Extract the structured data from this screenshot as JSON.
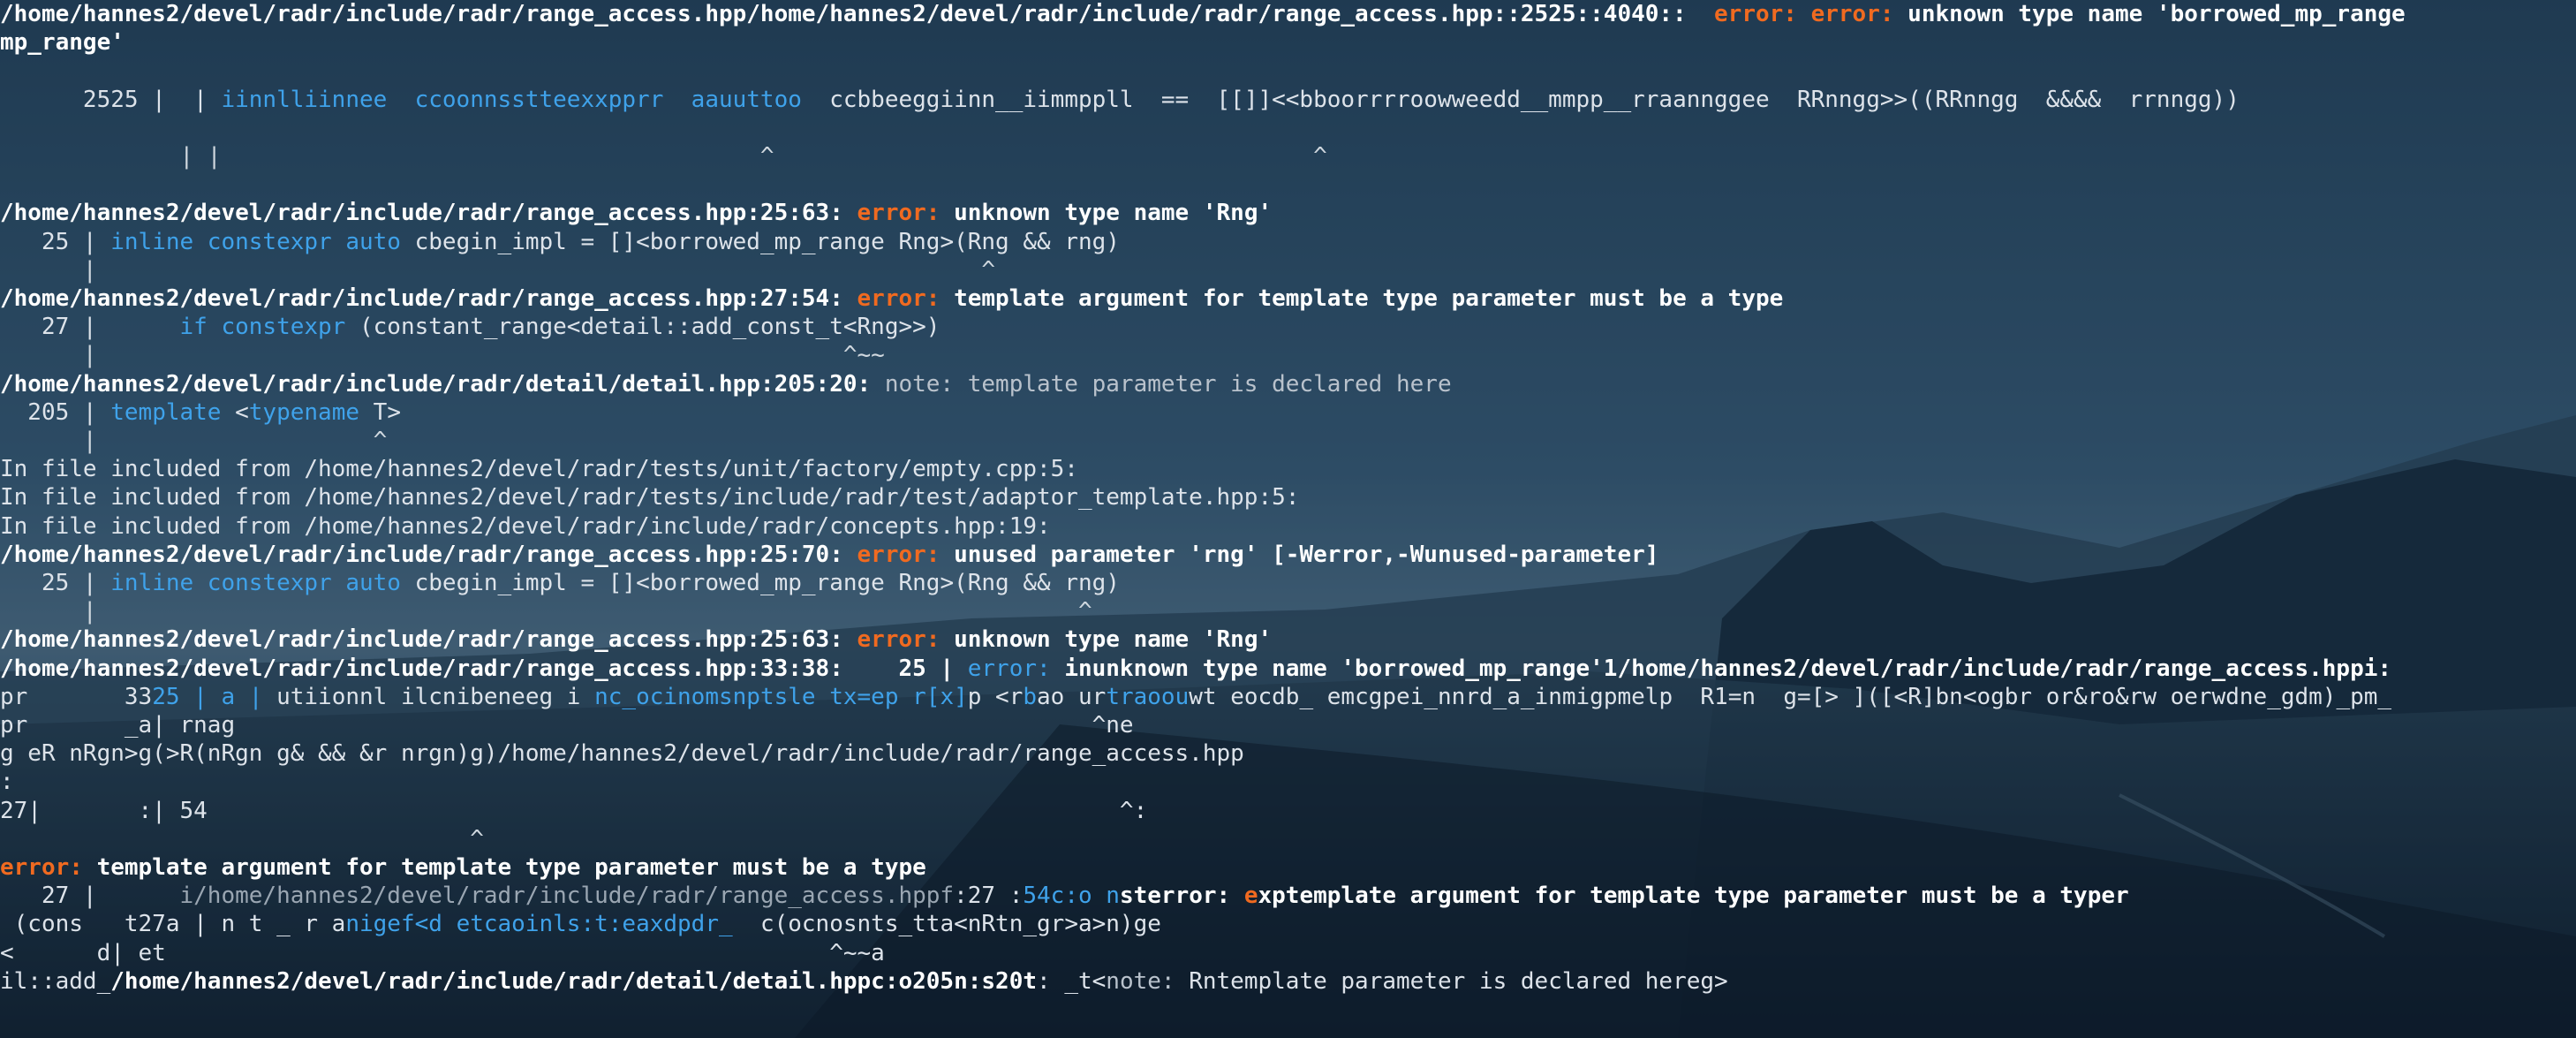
{
  "theme": {
    "bg": "#1d3b52",
    "error": "#f06a20",
    "keyword": "#3fa2ea",
    "text": "#dde3ea"
  },
  "lines": [
    [
      {
        "t": "path",
        "v": "/home/hannes2/devel/radr/include/radr/range_access.hpp/home/hannes2/devel/radr/include/radr/range_access.hpp::2525::4040::  "
      },
      {
        "t": "err",
        "v": "error: error: "
      },
      {
        "t": "msg",
        "v": "unknown type name 'borrowed_mp_range"
      }
    ],
    [
      {
        "t": "path",
        "v": "mp_range'"
      }
    ],
    [],
    [
      {
        "t": "code",
        "v": "      2525 |  | "
      },
      {
        "t": "kw",
        "v": "iinnlliinnee  ccoonnsstteexxpprr  aauuttoo"
      },
      {
        "t": "code",
        "v": "  ccbbeeggiinn__iimmppll  ==  [[]]<<bboorrrroowweedd__mmpp__rraannggee  RRnngg>>((RRnngg  &&&&  rrnngg))"
      }
    ],
    [],
    [
      {
        "t": "caret",
        "v": "             | |                                       ^                                       ^"
      }
    ],
    [],
    [
      {
        "t": "path",
        "v": "/home/hannes2/devel/radr/include/radr/range_access.hpp:25:63: "
      },
      {
        "t": "err",
        "v": "error: "
      },
      {
        "t": "msg",
        "v": "unknown type name 'Rng'"
      }
    ],
    [
      {
        "t": "code",
        "v": "   25 | "
      },
      {
        "t": "kw",
        "v": "inline constexpr auto"
      },
      {
        "t": "code",
        "v": " cbegin_impl = []<borrowed_mp_range Rng>(Rng && rng)"
      }
    ],
    [
      {
        "t": "caret",
        "v": "      |                                                                ^"
      }
    ],
    [
      {
        "t": "path",
        "v": "/home/hannes2/devel/radr/include/radr/range_access.hpp:27:54: "
      },
      {
        "t": "err",
        "v": "error: "
      },
      {
        "t": "msg",
        "v": "template argument for template type parameter must be a type"
      }
    ],
    [
      {
        "t": "code",
        "v": "   27 |      "
      },
      {
        "t": "kw",
        "v": "if constexpr"
      },
      {
        "t": "code",
        "v": " (constant_range<detail::add_const_t<Rng>>)"
      }
    ],
    [
      {
        "t": "caret",
        "v": "      |                                                      ^~~"
      }
    ],
    [
      {
        "t": "path",
        "v": "/home/hannes2/devel/radr/include/radr/detail/detail.hpp:205:20: "
      },
      {
        "t": "note",
        "v": "note: "
      },
      {
        "t": "note",
        "v": "template parameter is declared here"
      }
    ],
    [
      {
        "t": "code",
        "v": "  205 | "
      },
      {
        "t": "kw",
        "v": "template"
      },
      {
        "t": "code",
        "v": " <"
      },
      {
        "t": "kw",
        "v": "typename"
      },
      {
        "t": "code",
        "v": " T>"
      }
    ],
    [
      {
        "t": "caret",
        "v": "      |                    ^"
      }
    ],
    [
      {
        "t": "code",
        "v": "In file included from /home/hannes2/devel/radr/tests/unit/factory/empty.cpp:5:"
      }
    ],
    [
      {
        "t": "code",
        "v": "In file included from /home/hannes2/devel/radr/tests/include/radr/test/adaptor_template.hpp:5:"
      }
    ],
    [
      {
        "t": "code",
        "v": "In file included from /home/hannes2/devel/radr/include/radr/concepts.hpp:19:"
      }
    ],
    [
      {
        "t": "path",
        "v": "/home/hannes2/devel/radr/include/radr/range_access.hpp:25:70: "
      },
      {
        "t": "err",
        "v": "error: "
      },
      {
        "t": "msg",
        "v": "unused parameter 'rng' [-Werror,-Wunused-parameter]"
      }
    ],
    [
      {
        "t": "code",
        "v": "   25 | "
      },
      {
        "t": "kw",
        "v": "inline constexpr auto"
      },
      {
        "t": "code",
        "v": " cbegin_impl = []<borrowed_mp_range Rng>(Rng && rng)"
      }
    ],
    [
      {
        "t": "caret",
        "v": "      |                                                                       ^"
      }
    ],
    [
      {
        "t": "path",
        "v": "/home/hannes2/devel/radr/include/radr/range_access.hpp:25:63: "
      },
      {
        "t": "err",
        "v": "error: "
      },
      {
        "t": "msg",
        "v": "unknown type name 'Rng'"
      }
    ],
    [
      {
        "t": "path",
        "v": "/home/hannes2/devel/radr/include/radr/range_access.hpp:33:38:    25 | "
      },
      {
        "t": "kw",
        "v": "error: "
      },
      {
        "t": "msg",
        "v": "inunknown type name 'borrowed_mp_range'1/home/hannes2/devel/radr/include/radr/range_access.hppi:"
      }
    ],
    [
      {
        "t": "code",
        "v": "pr       33"
      },
      {
        "t": "kw",
        "v": "25 | a |"
      },
      {
        "t": "code",
        "v": " utiionnl ilcnibeneeg i "
      },
      {
        "t": "kw",
        "v": "nc_ocinomsnptsle tx=ep r[x]"
      },
      {
        "t": "code",
        "v": "p <r"
      },
      {
        "t": "kw",
        "v": "b"
      },
      {
        "t": "code",
        "v": "ao ur"
      },
      {
        "t": "kw",
        "v": "traoou"
      },
      {
        "t": "code",
        "v": "wt eocdb_ emcgpei_nnrd_a_inmigpmelp  R1=n  g=[> ]([<R]bn<ogbr or&ro&rw oerwdne_gdm)_pm_"
      }
    ],
    [
      {
        "t": "code",
        "v": "pr       _a| rnag                                                              ^ne"
      }
    ],
    [
      {
        "t": "code",
        "v": "g eR nRgn>g(>R(nRgn g& && &r nrgn)g)/home/hannes2/devel/radr/include/radr/range_access.hpp"
      }
    ],
    [
      {
        "t": "code",
        "v": ":"
      }
    ],
    [
      {
        "t": "code",
        "v": "27|       :| 54                                                                  ^:"
      }
    ],
    [
      {
        "t": "caret",
        "v": "                                  ^"
      }
    ],
    [
      {
        "t": "err",
        "v": "error: "
      },
      {
        "t": "msg",
        "v": "template argument for template type parameter must be a type"
      }
    ],
    [
      {
        "t": "code",
        "v": "   27 |      "
      },
      {
        "t": "dim",
        "v": "i/home/hannes2/devel/radr/include/radr/range_access.hppf"
      },
      {
        "t": "code",
        "v": ":27 :"
      },
      {
        "t": "kw",
        "v": "54c:o n"
      },
      {
        "t": "msg",
        "v": "sterror: "
      },
      {
        "t": "err",
        "v": "e"
      },
      {
        "t": "msg",
        "v": "xptemplate argument for template type parameter must be a typer"
      }
    ],
    [
      {
        "t": "code",
        "v": " (cons   t27a | n t _ r a"
      },
      {
        "t": "kw",
        "v": "nigef<d etcaoinls:t:eaxdpdr_"
      },
      {
        "t": "code",
        "v": "  c(ocnosnts_tta<nRtn_gr>a>n)ge"
      }
    ],
    [
      {
        "t": "code",
        "v": "<      d| et                                                ^~~a"
      }
    ],
    [
      {
        "t": "code",
        "v": "il::add_"
      },
      {
        "t": "path",
        "v": "/home/hannes2/devel/radr/include/radr/detail/detail.hppc:o205n:s20t"
      },
      {
        "t": "code",
        "v": ": _t<"
      },
      {
        "t": "note",
        "v": "note: "
      },
      {
        "t": "code",
        "v": "Rntemplate parameter is declared hereg>"
      }
    ]
  ]
}
